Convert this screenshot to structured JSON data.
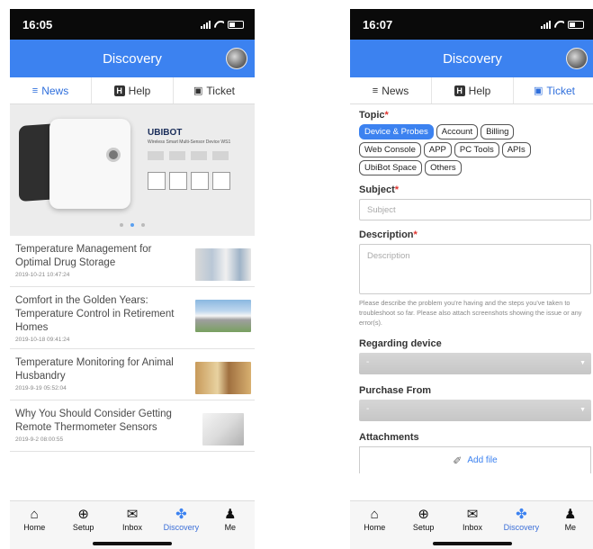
{
  "left": {
    "status_time": "16:05",
    "appbar_title": "Discovery",
    "tabs": [
      {
        "label": "News",
        "icon": "rss-icon"
      },
      {
        "label": "Help",
        "icon": "help-icon"
      },
      {
        "label": "Ticket",
        "icon": "ticket-icon"
      }
    ],
    "banner": {
      "brand": "UBIBOT",
      "subtitle": "Wireless Smart Multi-Sensor Device WS1",
      "carousel_active_index": 1
    },
    "news": [
      {
        "title": "Temperature Management for Optimal Drug Storage",
        "date": "2019-10-21 10:47:24"
      },
      {
        "title": "Comfort in the Golden Years: Temperature Control in Retirement Homes",
        "date": "2019-10-18 09:41:24"
      },
      {
        "title": "Temperature Monitoring for Animal Husbandry",
        "date": "2019-9-19 05:52:04"
      },
      {
        "title": "Why You Should Consider Getting Remote Thermometer Sensors",
        "date": "2019-9-2 08:00:55"
      }
    ]
  },
  "right": {
    "status_time": "16:07",
    "appbar_title": "Discovery",
    "tabs": [
      {
        "label": "News",
        "icon": "rss-icon"
      },
      {
        "label": "Help",
        "icon": "help-icon"
      },
      {
        "label": "Ticket",
        "icon": "ticket-icon"
      }
    ],
    "form": {
      "topic_label": "Topic",
      "topics": [
        "Device & Probes",
        "Account",
        "Billing",
        "Web Console",
        "APP",
        "PC Tools",
        "APIs",
        "UbiBot Space",
        "Others"
      ],
      "topic_selected": "Device & Probes",
      "subject_label": "Subject",
      "subject_placeholder": "Subject",
      "description_label": "Description",
      "description_placeholder": "Description",
      "description_hint": "Please describe the problem you're having and the steps you've taken to troubleshoot so far. Please also attach screenshots showing the issue or any error(s).",
      "device_label": "Regarding device",
      "device_value": "-",
      "purchase_label": "Purchase From",
      "purchase_value": "-",
      "attachments_label": "Attachments",
      "add_file_label": "Add file"
    }
  },
  "bottom_nav": [
    {
      "label": "Home",
      "icon": "home-icon"
    },
    {
      "label": "Setup",
      "icon": "plus-circle-icon"
    },
    {
      "label": "Inbox",
      "icon": "envelope-icon"
    },
    {
      "label": "Discovery",
      "icon": "fan-icon"
    },
    {
      "label": "Me",
      "icon": "person-icon"
    }
  ],
  "colors": {
    "accent": "#3c82f0",
    "required": "#e0342f",
    "statusbar": "#0a0a0a"
  }
}
